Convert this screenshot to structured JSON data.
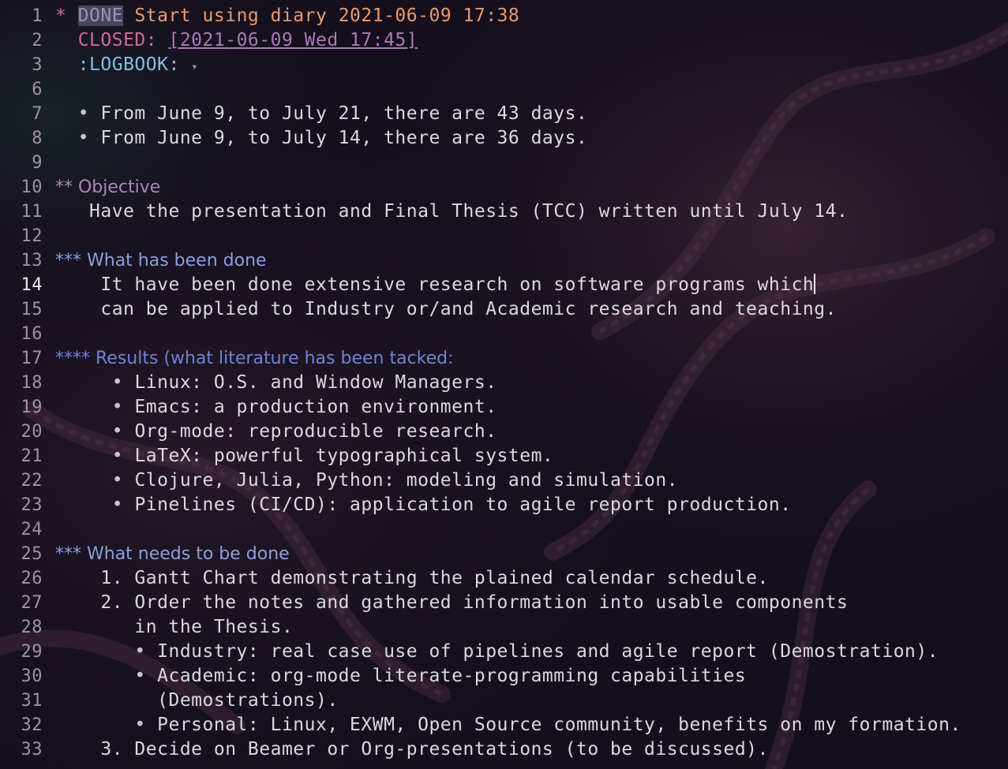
{
  "editor": {
    "current_line": "14",
    "lines": [
      {
        "num": "1",
        "parts": [
          {
            "t": "* ",
            "c": "star1"
          },
          {
            "t": "DONE",
            "c": "todo-done"
          },
          {
            "t": " Start using diary 2021-06-09 17:38",
            "c": "h1"
          }
        ]
      },
      {
        "num": "2",
        "parts": [
          {
            "t": "  CLOSED: ",
            "c": "closed-kw"
          },
          {
            "t": "[2021-06-09 Wed 17:45]",
            "c": "timestamp"
          }
        ]
      },
      {
        "num": "3",
        "parts": [
          {
            "t": "  :LOGBOOK: ",
            "c": "drawer"
          },
          {
            "t": "▾",
            "c": "fold-arrow"
          }
        ]
      },
      {
        "num": "6",
        "parts": []
      },
      {
        "num": "7",
        "parts": [
          {
            "t": "  • ",
            "c": "bullet"
          },
          {
            "t": "From June 9, to July 21, there are 43 days.",
            "c": ""
          }
        ]
      },
      {
        "num": "8",
        "parts": [
          {
            "t": "  • ",
            "c": "bullet"
          },
          {
            "t": "From June 9, to July 14, there are 36 days.",
            "c": ""
          }
        ]
      },
      {
        "num": "9",
        "parts": []
      },
      {
        "num": "10",
        "parts": [
          {
            "t": "** Objective",
            "c": "h2 sans"
          }
        ]
      },
      {
        "num": "11",
        "parts": [
          {
            "t": "   Have the presentation and Final Thesis (TCC) written until July 14.",
            "c": ""
          }
        ]
      },
      {
        "num": "12",
        "parts": []
      },
      {
        "num": "13",
        "parts": [
          {
            "t": "*** What has been done",
            "c": "h3 sans"
          }
        ]
      },
      {
        "num": "14",
        "parts": [
          {
            "t": "    It have been done extensive research on software programs which",
            "c": ""
          }
        ],
        "cursor": true
      },
      {
        "num": "15",
        "parts": [
          {
            "t": "    can be applied to Industry or/and Academic research and teaching.",
            "c": ""
          }
        ]
      },
      {
        "num": "16",
        "parts": []
      },
      {
        "num": "17",
        "parts": [
          {
            "t": "**** Results (what literature has been tacked:",
            "c": "h4 sans"
          }
        ]
      },
      {
        "num": "18",
        "parts": [
          {
            "t": "     • ",
            "c": "bullet"
          },
          {
            "t": "Linux: O.S. and Window Managers.",
            "c": ""
          }
        ]
      },
      {
        "num": "19",
        "parts": [
          {
            "t": "     • ",
            "c": "bullet"
          },
          {
            "t": "Emacs: a production environment.",
            "c": ""
          }
        ]
      },
      {
        "num": "20",
        "parts": [
          {
            "t": "     • ",
            "c": "bullet"
          },
          {
            "t": "Org-mode: reproducible research.",
            "c": ""
          }
        ]
      },
      {
        "num": "21",
        "parts": [
          {
            "t": "     • ",
            "c": "bullet"
          },
          {
            "t": "LaTeX: powerful typographical system.",
            "c": ""
          }
        ]
      },
      {
        "num": "22",
        "parts": [
          {
            "t": "     • ",
            "c": "bullet"
          },
          {
            "t": "Clojure, Julia, Python: modeling and simulation.",
            "c": ""
          }
        ]
      },
      {
        "num": "23",
        "parts": [
          {
            "t": "     • ",
            "c": "bullet"
          },
          {
            "t": "Pinelines (CI/CD): application to agile report production.",
            "c": ""
          }
        ]
      },
      {
        "num": "24",
        "parts": []
      },
      {
        "num": "25",
        "parts": [
          {
            "t": "*** What needs to be done",
            "c": "h3 sans"
          }
        ]
      },
      {
        "num": "26",
        "parts": [
          {
            "t": "    1. Gantt Chart demonstrating the plained calendar schedule.",
            "c": ""
          }
        ]
      },
      {
        "num": "27",
        "parts": [
          {
            "t": "    2. Order the notes and gathered information into usable components",
            "c": ""
          }
        ]
      },
      {
        "num": "28",
        "parts": [
          {
            "t": "       in the Thesis.",
            "c": ""
          }
        ]
      },
      {
        "num": "29",
        "parts": [
          {
            "t": "       • ",
            "c": "bullet"
          },
          {
            "t": "Industry: real case use of pipelines and agile report (Demostration).",
            "c": ""
          }
        ]
      },
      {
        "num": "30",
        "parts": [
          {
            "t": "       • ",
            "c": "bullet"
          },
          {
            "t": "Academic: org-mode literate-programming capabilities",
            "c": ""
          }
        ]
      },
      {
        "num": "31",
        "parts": [
          {
            "t": "         (Demostrations).",
            "c": ""
          }
        ]
      },
      {
        "num": "32",
        "parts": [
          {
            "t": "       • ",
            "c": "bullet"
          },
          {
            "t": "Personal: Linux, EXWM, Open Source community, benefits on my formation.",
            "c": ""
          }
        ]
      },
      {
        "num": "33",
        "parts": [
          {
            "t": "    3. Decide on Beamer or Org-presentations (to be discussed).",
            "c": ""
          }
        ]
      }
    ]
  }
}
